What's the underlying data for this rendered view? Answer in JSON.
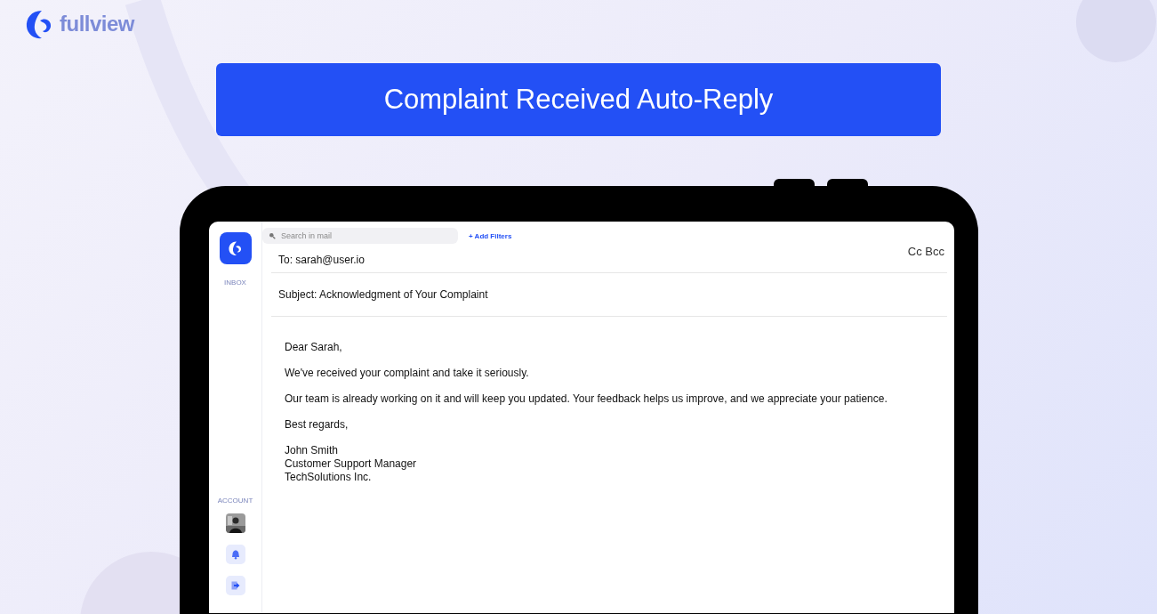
{
  "logo": {
    "text": "fullview"
  },
  "banner": {
    "title": "Complaint Received Auto-Reply"
  },
  "sidebar": {
    "inbox_label": "INBOX",
    "account_label": "ACCOUNT"
  },
  "search": {
    "placeholder": "Search in mail"
  },
  "add_filters": "+ Add Filters",
  "compose": {
    "to": "To: sarah@user.io",
    "cc_bcc": "Cc Bcc",
    "subject": "Subject: Acknowledgment of Your Complaint",
    "paragraphs": [
      "Dear Sarah,",
      "We've received your complaint and take it seriously.",
      "Our team is already working on it and will keep you updated. Your feedback helps us improve, and we appreciate your patience.",
      "Best regards,"
    ],
    "signature": [
      "John Smith",
      "Customer Support Manager",
      "TechSolutions Inc."
    ]
  }
}
